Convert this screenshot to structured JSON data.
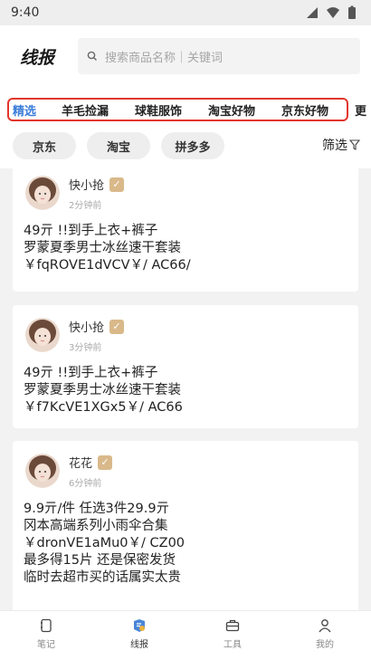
{
  "status_bar": {
    "time": "9:40"
  },
  "header": {
    "logo": "线报",
    "search_placeholder": "搜索商品名称｜关键词"
  },
  "tabs": [
    {
      "label": "精选",
      "active": true
    },
    {
      "label": "羊毛捡漏",
      "active": false
    },
    {
      "label": "球鞋服饰",
      "active": false
    },
    {
      "label": "淘宝好物",
      "active": false
    },
    {
      "label": "京东好物",
      "active": false
    },
    {
      "label": "更",
      "active": false
    }
  ],
  "platforms": [
    {
      "label": "京东"
    },
    {
      "label": "淘宝"
    },
    {
      "label": "拼多多"
    }
  ],
  "filter_label": "筛选",
  "posts": [
    {
      "user": "快小抢",
      "badge": "✓",
      "time": "2分钟前",
      "lines": [
        "49亓 !!到手上衣+裤子",
        "罗蒙夏季男士冰丝速干套装",
        "￥fqROVE1dVCV￥/ AC66/"
      ]
    },
    {
      "user": "快小抢",
      "badge": "✓",
      "time": "3分钟前",
      "lines": [
        "49亓 !!到手上衣+裤子",
        "罗蒙夏季男士冰丝速干套装",
        "￥f7KcVE1XGx5￥/ AC66"
      ]
    },
    {
      "user": "花花",
      "badge": "✓",
      "time": "6分钟前",
      "lines": [
        "9.9亓/件 任选3件29.9亓",
        "冈本高端系列小雨伞合集",
        "￥dronVE1aMu0￥/ CZ00",
        "最多得15片 还是保密发货",
        "临时去超市买的话属实太贵"
      ]
    }
  ],
  "bottom_nav": [
    {
      "label": "笔记",
      "icon": "notebook-icon"
    },
    {
      "label": "线报",
      "icon": "news-icon"
    },
    {
      "label": "工具",
      "icon": "toolbox-icon"
    },
    {
      "label": "我的",
      "icon": "person-icon"
    }
  ],
  "colors": {
    "accent": "#3b7dd8",
    "highlight_outline": "#e2352b",
    "badge": "#d9b98a"
  }
}
